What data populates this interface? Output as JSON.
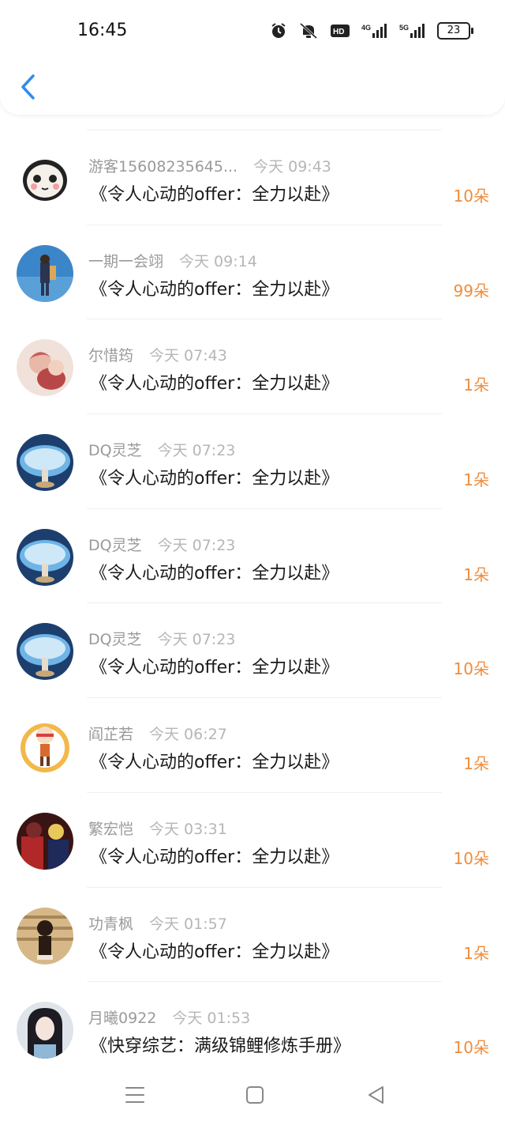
{
  "status_bar": {
    "time": "16:45",
    "battery": "23"
  },
  "header": {
    "back_icon": "chevron-left-icon"
  },
  "records": [
    {
      "user": "游客15608235645...",
      "time": "今天 09:43",
      "title": "《令人心动的offer：全力以赴》",
      "amount": "10朵"
    },
    {
      "user": "一期一会翊",
      "time": "今天 09:14",
      "title": "《令人心动的offer：全力以赴》",
      "amount": "99朵"
    },
    {
      "user": "尔惜筠",
      "time": "今天 07:43",
      "title": "《令人心动的offer：全力以赴》",
      "amount": "1朵"
    },
    {
      "user": "DQ灵芝",
      "time": "今天 07:23",
      "title": "《令人心动的offer：全力以赴》",
      "amount": "1朵"
    },
    {
      "user": "DQ灵芝",
      "time": "今天 07:23",
      "title": "《令人心动的offer：全力以赴》",
      "amount": "1朵"
    },
    {
      "user": "DQ灵芝",
      "time": "今天 07:23",
      "title": "《令人心动的offer：全力以赴》",
      "amount": "10朵"
    },
    {
      "user": "阎芷若",
      "time": "今天 06:27",
      "title": "《令人心动的offer：全力以赴》",
      "amount": "1朵"
    },
    {
      "user": "繁宏恺",
      "time": "今天 03:31",
      "title": "《令人心动的offer：全力以赴》",
      "amount": "10朵"
    },
    {
      "user": "功青枫",
      "time": "今天 01:57",
      "title": "《令人心动的offer：全力以赴》",
      "amount": "1朵"
    },
    {
      "user": "月曦0922",
      "time": "今天 01:53",
      "title": "《快穿综艺：满级锦鲤修炼手册》",
      "amount": "10朵"
    }
  ],
  "colors": {
    "accent": "#2f8cf0",
    "amount": "#f08c3c",
    "muted": "#9a9a9a"
  },
  "nav": [
    "menu-icon",
    "home-square-icon",
    "back-triangle-icon"
  ]
}
